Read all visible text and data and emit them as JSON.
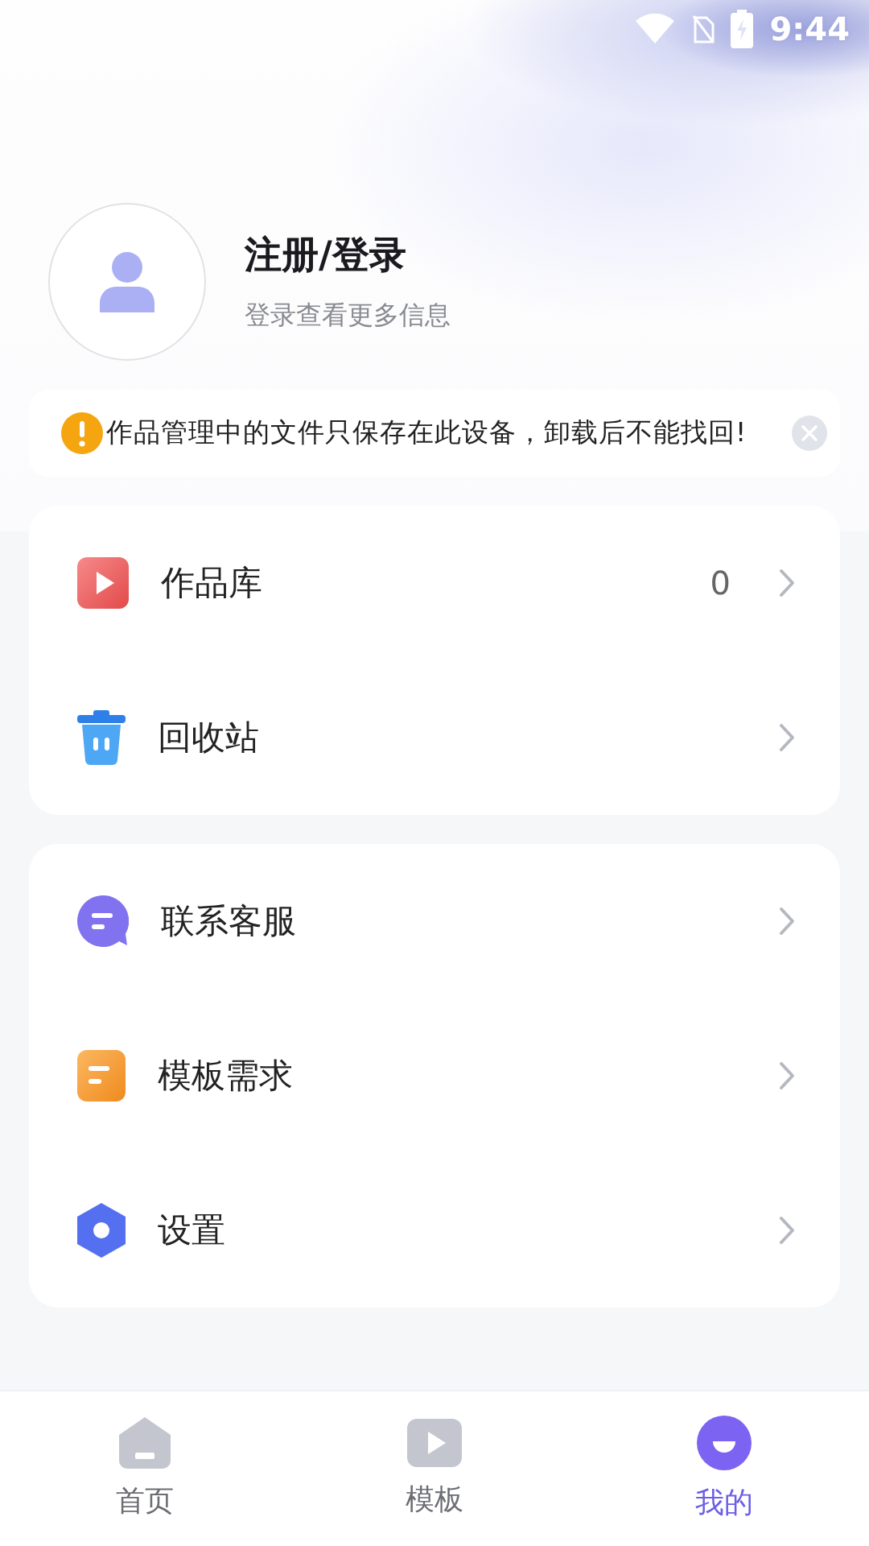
{
  "status_bar": {
    "time": "9:44"
  },
  "profile": {
    "title": "注册/登录",
    "subtitle": "登录查看更多信息"
  },
  "notice": {
    "text": "作品管理中的文件只保存在此设备，卸载后不能找回!"
  },
  "menu_groups": [
    {
      "items": [
        {
          "kind": "works",
          "label": "作品库",
          "count": "0"
        },
        {
          "kind": "trash",
          "label": "回收站"
        }
      ]
    },
    {
      "items": [
        {
          "kind": "support",
          "label": "联系客服"
        },
        {
          "kind": "request",
          "label": "模板需求"
        },
        {
          "kind": "settings",
          "label": "设置"
        }
      ]
    }
  ],
  "bottom_nav": [
    {
      "kind": "home",
      "label": "首页",
      "selected": false
    },
    {
      "kind": "template",
      "label": "模板",
      "selected": false
    },
    {
      "kind": "mine",
      "label": "我的",
      "selected": true
    }
  ]
}
